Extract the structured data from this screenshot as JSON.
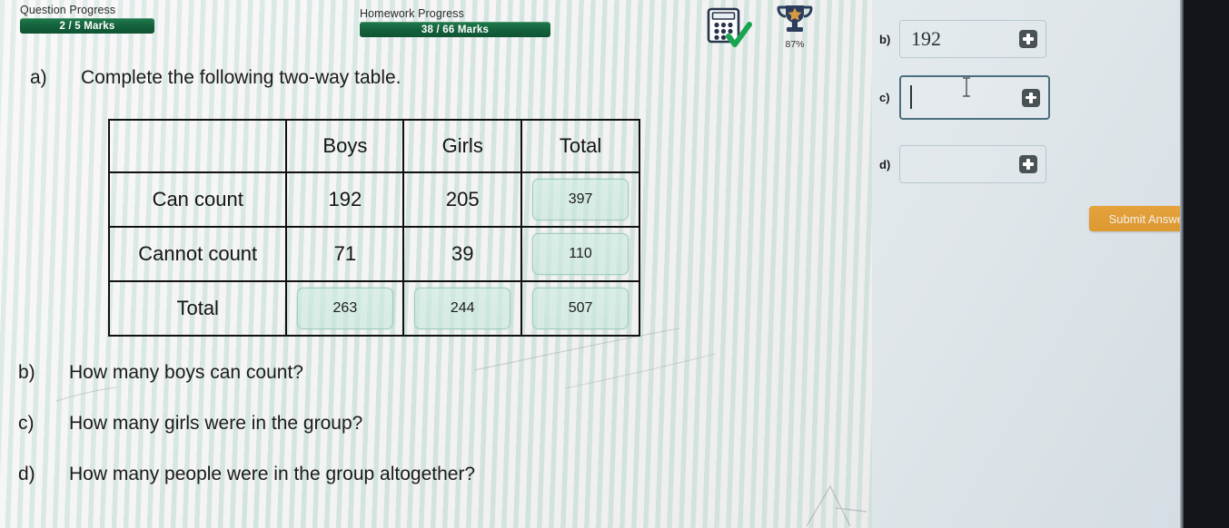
{
  "header": {
    "question_progress_label": "Question Progress",
    "question_progress_value": "2 / 5 Marks",
    "homework_progress_label": "Homework Progress",
    "homework_progress_value": "38 / 66 Marks",
    "calculator_icon": "calculator-allowed-icon",
    "trophy_icon": "trophy-icon",
    "trophy_percent": "87%",
    "progress_bar_color": "#14603b",
    "accent_color": "#dd9830"
  },
  "worksheet": {
    "part_a": {
      "letter": "a)",
      "text": "Complete the following two-way table."
    },
    "part_b": {
      "letter": "b)",
      "text": "How many boys can count?"
    },
    "part_c": {
      "letter": "c)",
      "text": "How many girls were in the group?"
    },
    "part_d": {
      "letter": "d)",
      "text": "How many people were in the group altogether?"
    }
  },
  "table": {
    "headers": [
      "",
      "Boys",
      "Girls",
      "Total"
    ],
    "rows": [
      {
        "label": "Can count",
        "cells": [
          {
            "value": "192",
            "editable": false
          },
          {
            "value": "205",
            "editable": false
          },
          {
            "value": "397",
            "editable": true
          }
        ]
      },
      {
        "label": "Cannot count",
        "cells": [
          {
            "value": "71",
            "editable": false
          },
          {
            "value": "39",
            "editable": false
          },
          {
            "value": "110",
            "editable": true
          }
        ]
      },
      {
        "label": "Total",
        "cells": [
          {
            "value": "263",
            "editable": true
          },
          {
            "value": "244",
            "editable": true
          },
          {
            "value": "507",
            "editable": true
          }
        ]
      }
    ]
  },
  "answers": {
    "b": {
      "letter": "b)",
      "value": "192",
      "placeholder": "",
      "focused": false
    },
    "c": {
      "letter": "c)",
      "value": "",
      "placeholder": "",
      "focused": true
    },
    "d": {
      "letter": "d)",
      "value": "",
      "placeholder": "",
      "focused": false
    },
    "keypad_icon": "plus-square-icon"
  },
  "submit": {
    "label": "Submit Answer"
  }
}
